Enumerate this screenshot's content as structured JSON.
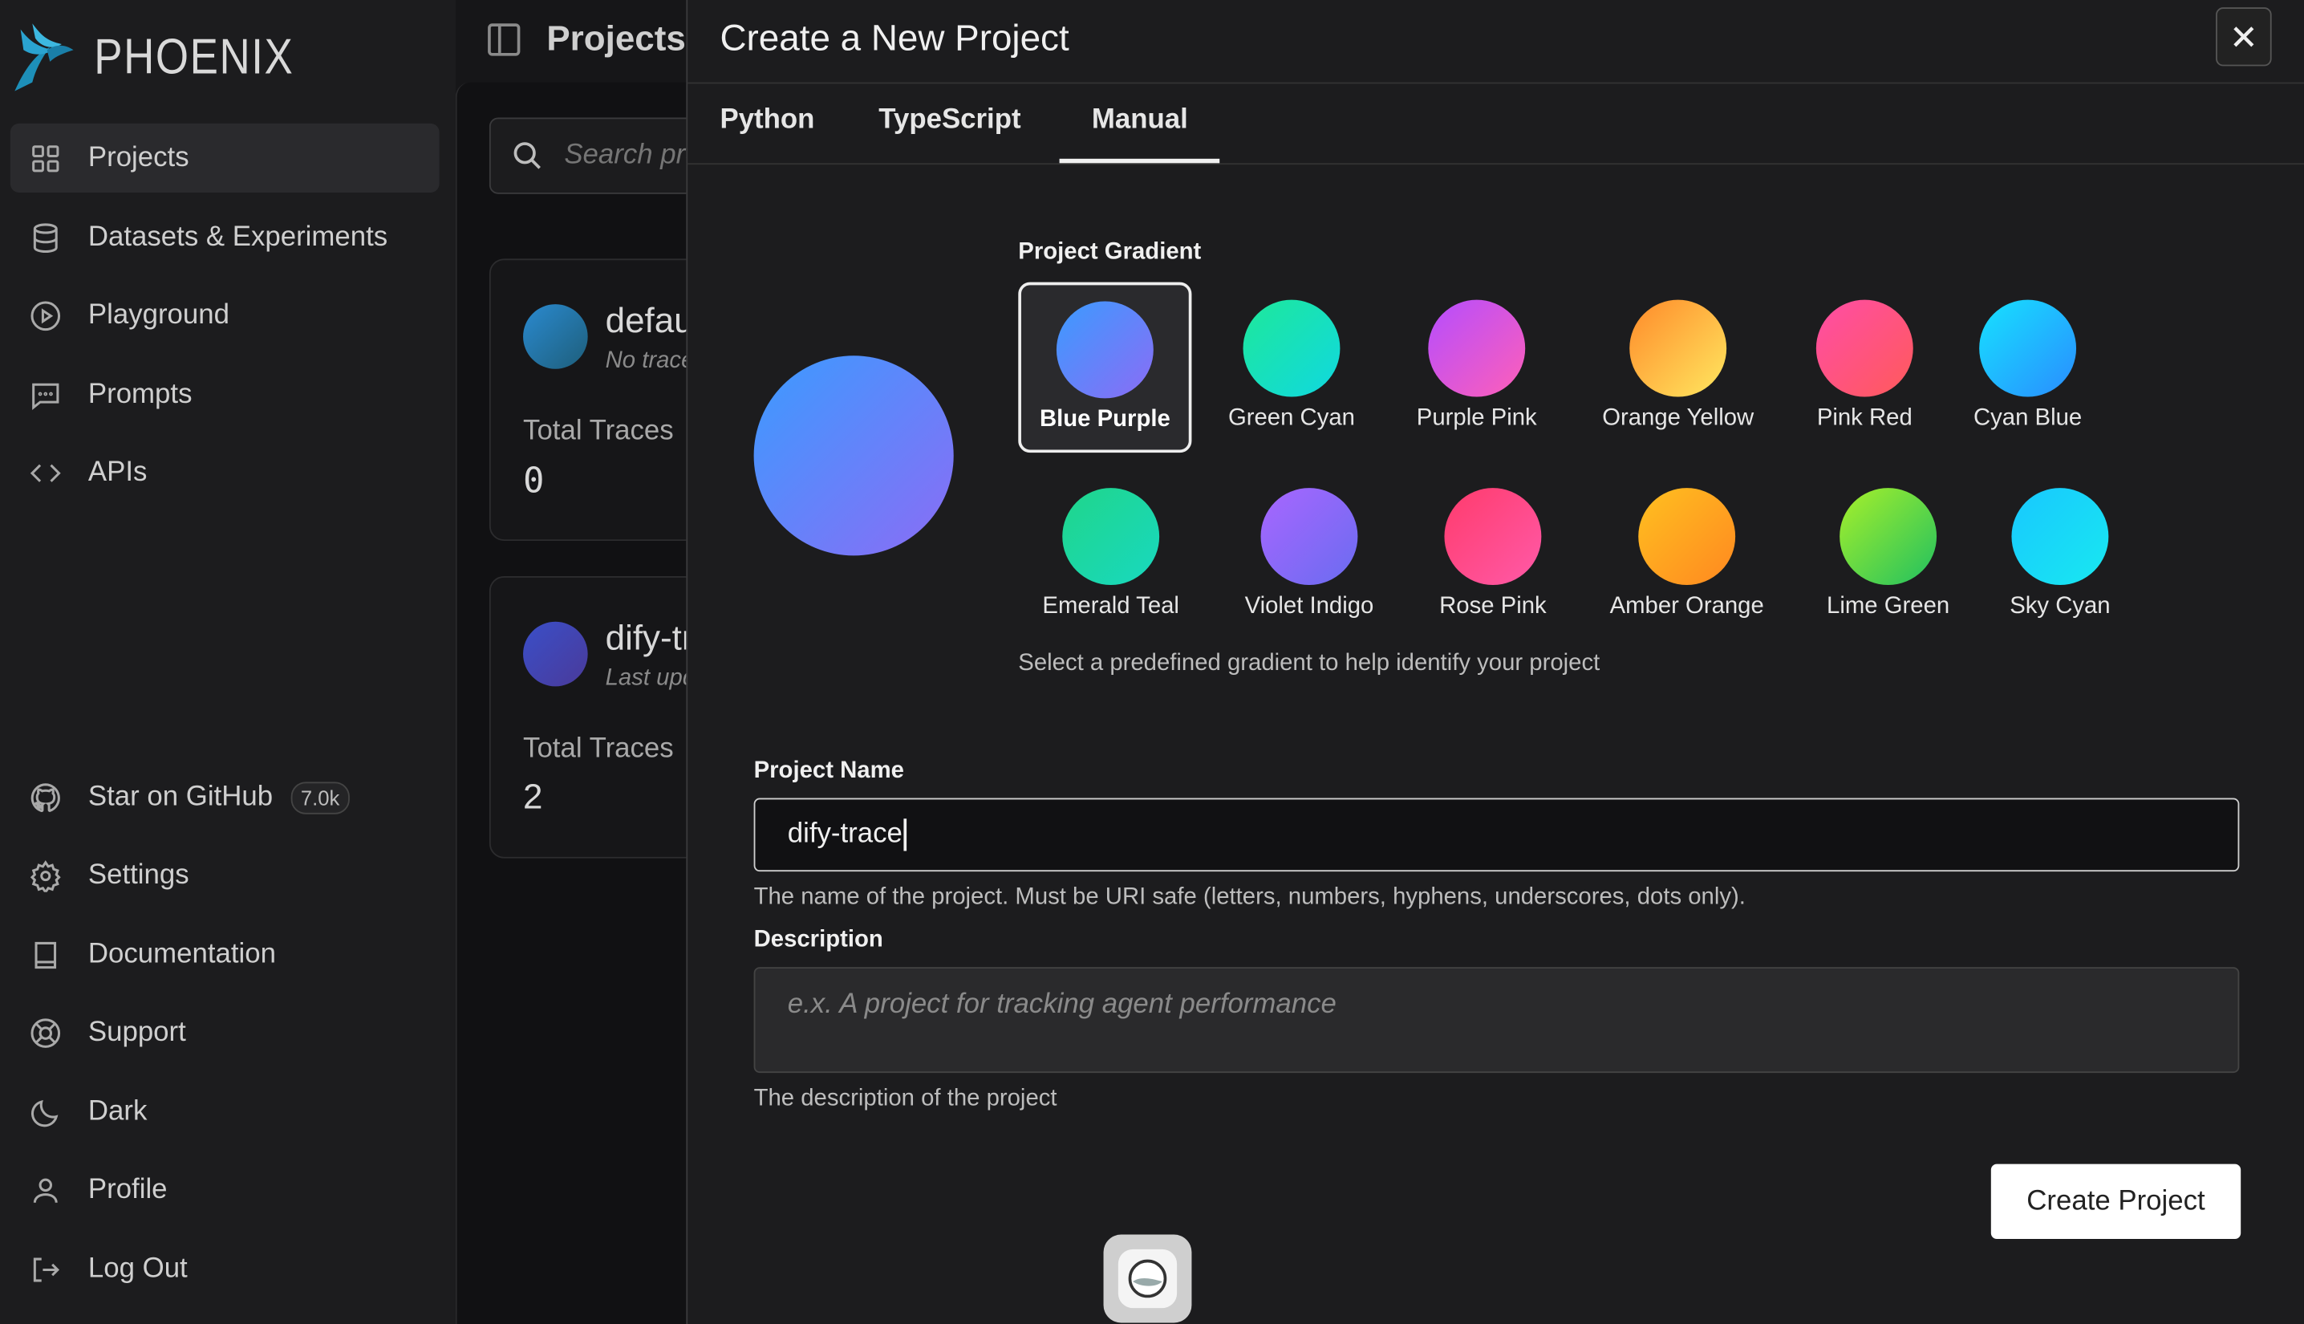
{
  "brand": {
    "name": "PHOENIX"
  },
  "sidebar": {
    "items": [
      {
        "label": "Projects",
        "icon": "grid-icon"
      },
      {
        "label": "Datasets & Experiments",
        "icon": "database-icon"
      },
      {
        "label": "Playground",
        "icon": "play-circle-icon"
      },
      {
        "label": "Prompts",
        "icon": "message-icon"
      },
      {
        "label": "APIs",
        "icon": "code-icon"
      }
    ],
    "bottom_items": [
      {
        "label": "Star on GitHub",
        "icon": "github-icon",
        "badge": "7.0k"
      },
      {
        "label": "Settings",
        "icon": "gear-icon"
      },
      {
        "label": "Documentation",
        "icon": "book-icon"
      },
      {
        "label": "Support",
        "icon": "lifebuoy-icon"
      },
      {
        "label": "Dark",
        "icon": "moon-icon"
      },
      {
        "label": "Profile",
        "icon": "user-icon"
      },
      {
        "label": "Log Out",
        "icon": "logout-icon"
      }
    ]
  },
  "main": {
    "title": "Projects",
    "search_placeholder": "Search projects",
    "cards": [
      {
        "name": "default",
        "sub": "No traces",
        "total_label": "Total Traces",
        "total_value": "0",
        "color_start": "#2a8ad0",
        "color_end": "#1e5e7a"
      },
      {
        "name": "dify-trace",
        "sub": "Last updated",
        "total_label": "Total Traces",
        "total_value": "2",
        "color_start": "#3a4fc8",
        "color_end": "#4a3a9a"
      }
    ]
  },
  "modal": {
    "title": "Create a New Project",
    "tabs": [
      "Python",
      "TypeScript",
      "Manual"
    ],
    "active_tab": "Manual",
    "gradient_label": "Project Gradient",
    "gradient_help": "Select a predefined gradient to help identify your project",
    "gradients": [
      {
        "label": "Blue Purple",
        "from": "#3b9bff",
        "to": "#8b6cf5",
        "selected": true
      },
      {
        "label": "Green Cyan",
        "from": "#1ee89a",
        "to": "#10d8e0"
      },
      {
        "label": "Purple Pink",
        "from": "#b44dff",
        "to": "#ff5fb8"
      },
      {
        "label": "Orange Yellow",
        "from": "#ff8a2a",
        "to": "#ffe860"
      },
      {
        "label": "Pink Red",
        "from": "#ff4da6",
        "to": "#ff5a5a"
      },
      {
        "label": "Cyan Blue",
        "from": "#16e2ff",
        "to": "#2a8cff"
      },
      {
        "label": "Emerald Teal",
        "from": "#20d68a",
        "to": "#18d8c0"
      },
      {
        "label": "Violet Indigo",
        "from": "#a866ff",
        "to": "#6a6cf0"
      },
      {
        "label": "Rose Pink",
        "from": "#ff3b6c",
        "to": "#ff5aa8"
      },
      {
        "label": "Amber Orange",
        "from": "#ffc020",
        "to": "#ff8820"
      },
      {
        "label": "Lime Green",
        "from": "#a8f02a",
        "to": "#20c060"
      },
      {
        "label": "Sky Cyan",
        "from": "#18c8ff",
        "to": "#18e8f0"
      }
    ],
    "name_label": "Project Name",
    "name_value": "dify-trace",
    "name_help": "The name of the project. Must be URI safe (letters, numbers, hyphens, underscores, dots only).",
    "desc_label": "Description",
    "desc_placeholder": "e.x. A project for tracking agent performance",
    "desc_help": "The description of the project",
    "submit_label": "Create Project"
  },
  "colors": {
    "accent": "#ffffff",
    "background": "#1c1c1e"
  }
}
